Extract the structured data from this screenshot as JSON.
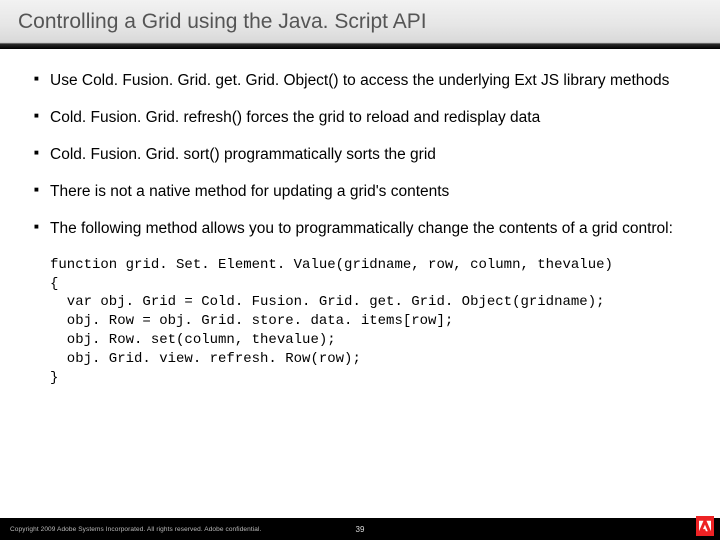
{
  "title": "Controlling a Grid using the Java. Script API",
  "bullets": [
    "Use Cold. Fusion. Grid. get. Grid. Object() to access the underlying Ext JS library methods",
    "Cold. Fusion. Grid. refresh() forces the grid to reload and redisplay data",
    "Cold. Fusion. Grid. sort() programmatically sorts the grid",
    "There is not a native method for updating a grid's contents",
    "The following method allows you to programmatically change the contents of a grid control:"
  ],
  "code": "function grid. Set. Element. Value(gridname, row, column, thevalue)\n{\n  var obj. Grid = Cold. Fusion. Grid. get. Grid. Object(gridname);\n  obj. Row = obj. Grid. store. data. items[row];\n  obj. Row. set(column, thevalue);\n  obj. Grid. view. refresh. Row(row);\n}",
  "footer": {
    "copyright": "Copyright 2009 Adobe Systems Incorporated.  All rights reserved.  Adobe confidential.",
    "page": "39"
  }
}
